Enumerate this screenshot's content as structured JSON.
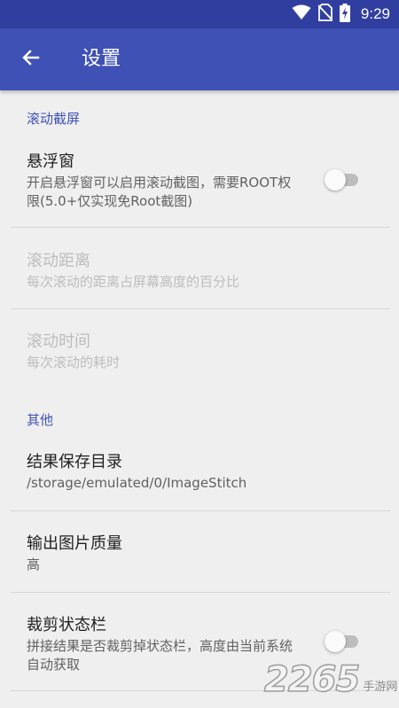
{
  "status_bar": {
    "time": "9:29",
    "icons": [
      "wifi-icon",
      "no-sim-icon",
      "battery-charging-icon"
    ]
  },
  "app_bar": {
    "back_icon": "arrow-back-icon",
    "title": "设置"
  },
  "sections": {
    "scroll_screenshot": {
      "header": "滚动截屏",
      "floating_window": {
        "title": "悬浮窗",
        "summary": "开启悬浮窗可以启用滚动截图，需要ROOT权限(5.0+仅实现免Root截图)",
        "enabled": false
      },
      "scroll_distance": {
        "title": "滚动距离",
        "summary": "每次滚动的距离占屏幕高度的百分比"
      },
      "scroll_time": {
        "title": "滚动时间",
        "summary": "每次滚动的耗时"
      }
    },
    "other": {
      "header": "其他",
      "save_dir": {
        "title": "结果保存目录",
        "summary": "/storage/emulated/0/ImageStitch"
      },
      "output_quality": {
        "title": "输出图片质量",
        "summary": "高"
      },
      "crop_status_bar": {
        "title": "裁剪状态栏",
        "summary": "拼接结果是否裁剪掉状态栏，高度由当前系统自动获取",
        "enabled": false
      }
    }
  },
  "watermark": {
    "number": "2265",
    "text": "手游网"
  },
  "colors": {
    "status_bar": "#303f9f",
    "app_bar": "#3f51b5",
    "accent": "#3f51b5",
    "background": "#efefef"
  }
}
